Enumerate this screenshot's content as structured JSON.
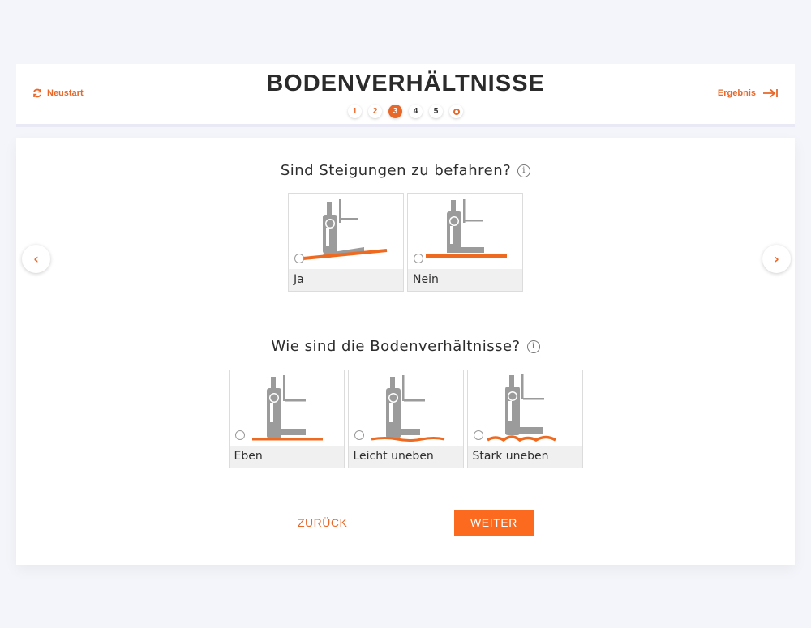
{
  "header": {
    "title": "BODENVERHÄLTNISSE",
    "restart_label": "Neustart",
    "result_label": "Ergebnis",
    "steps": [
      "1",
      "2",
      "3",
      "4",
      "5",
      ""
    ],
    "active_step": "3"
  },
  "questions": [
    {
      "text": "Sind Steigungen zu befahren?",
      "info_icon": "i",
      "options": [
        {
          "label": "Ja"
        },
        {
          "label": "Nein"
        }
      ]
    },
    {
      "text": "Wie sind die Bodenverhältnisse?",
      "info_icon": "i",
      "options": [
        {
          "label": "Eben"
        },
        {
          "label": "Leicht uneben"
        },
        {
          "label": "Stark uneben"
        }
      ]
    }
  ],
  "nav": {
    "prev_glyph": "‹",
    "next_glyph": "›"
  },
  "footer": {
    "back_label": "ZURÜCK",
    "next_label": "WEITER"
  },
  "colors": {
    "accent": "#e8682a",
    "button": "#fb6a1f",
    "forklift": "#9b9b9b",
    "background": "#f4f5fa"
  }
}
